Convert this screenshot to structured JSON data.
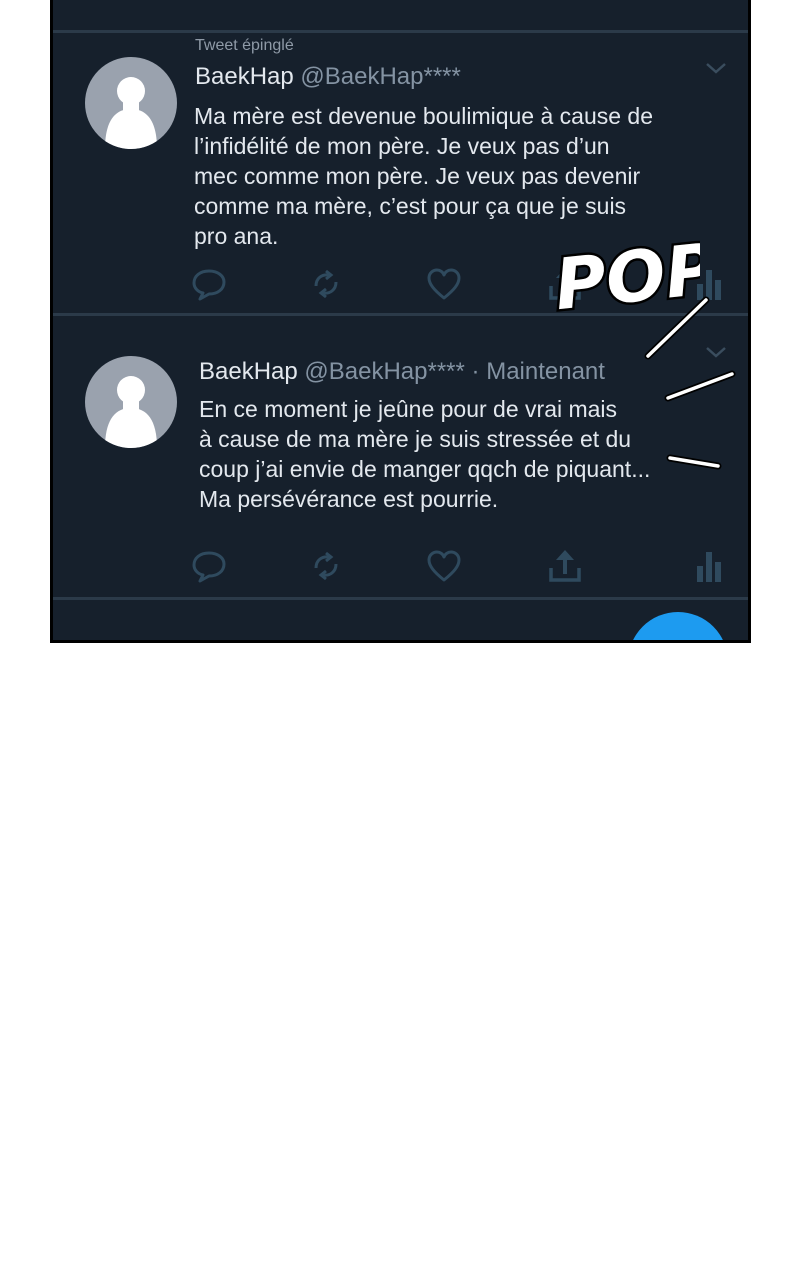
{
  "pinned_tweet": {
    "pinned_label": "Tweet épinglé",
    "name": "BaekHap",
    "handle": "@BaekHap****",
    "lines": [
      "Ma mère est devenue boulimique à cause de",
      "l’infidélité de mon père. Je veux pas d’un",
      "mec comme mon père. Je veux pas devenir",
      "comme ma mère, c’est pour ça que je suis",
      "pro ana."
    ]
  },
  "new_tweet": {
    "name": "BaekHap",
    "handle": "@BaekHap****",
    "separator": "·",
    "timestamp": "Maintenant",
    "lines": [
      "En ce moment je jeûne pour de vrai mais",
      "à cause de ma mère je suis stressée et du",
      "coup j’ai envie de manger qqch de piquant...",
      "Ma persévérance est pourrie."
    ]
  },
  "sound_effect": "POP",
  "icons": {
    "reply": "reply-icon",
    "retweet": "retweet-icon",
    "like": "heart-icon",
    "share": "share-icon",
    "analytics": "analytics-icon",
    "more": "chevron-down-icon",
    "avatar": "default-avatar-icon",
    "compose": "compose-button"
  },
  "colors": {
    "background": "#16202c",
    "text_primary": "#e3e8ee",
    "text_secondary": "#8493a3",
    "divider": "#2b3a49",
    "accent": "#1d9bf0",
    "icon": "#2f4a5e"
  }
}
